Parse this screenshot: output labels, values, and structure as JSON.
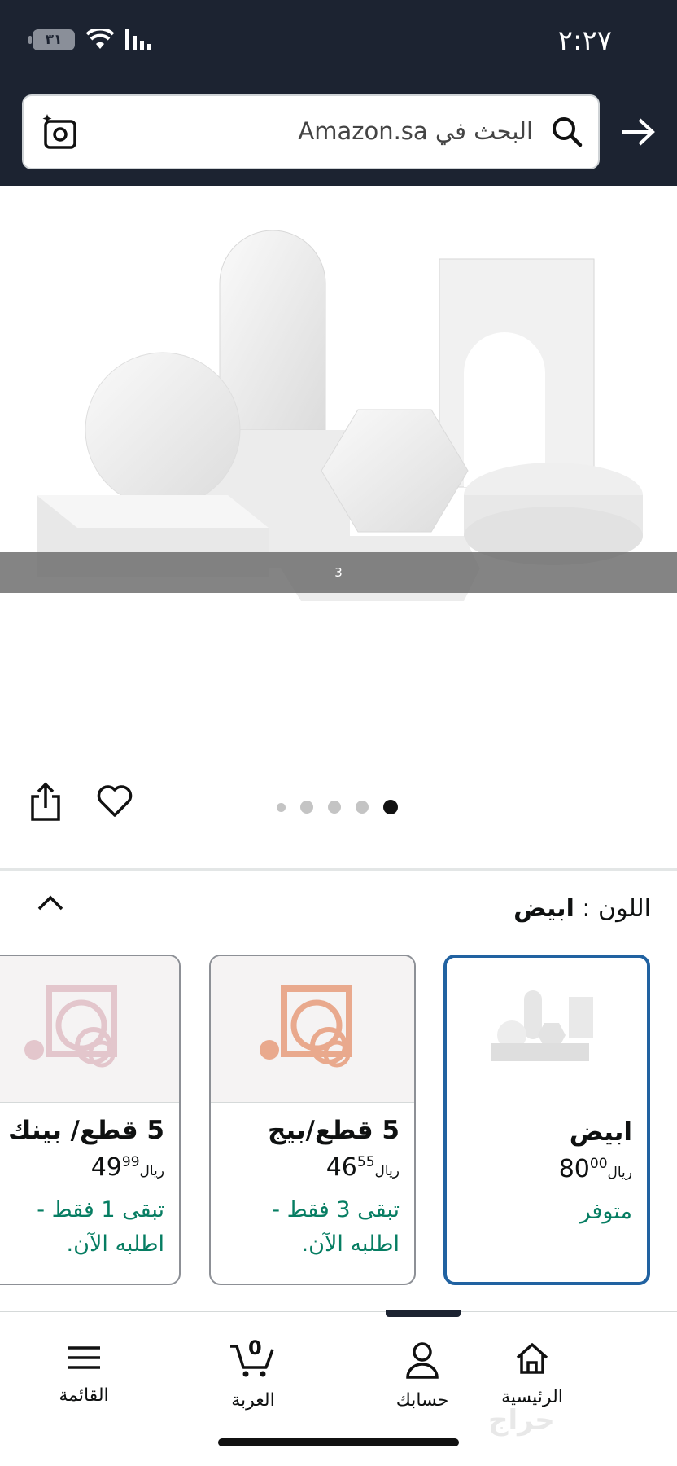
{
  "status_bar": {
    "time": "٢:٢٧",
    "battery": "٣١"
  },
  "search": {
    "placeholder": "البحث في Amazon.sa"
  },
  "gallery": {
    "overlay_text": "3",
    "total_images": 5,
    "active_index": 5
  },
  "variation": {
    "label": "اللون :",
    "selected": "ابيض"
  },
  "swatches": [
    {
      "name": "ابيض",
      "price_whole": "80",
      "price_fraction": "00",
      "currency": "ريال",
      "stock": "متوفر",
      "selected": true
    },
    {
      "name": "5 قطع/بيج",
      "price_whole": "46",
      "price_fraction": "55",
      "currency": "ريال",
      "stock": "تبقى 3 فقط - اطلبه الآن.",
      "selected": false
    },
    {
      "name": "5 قطع/ بينك",
      "price_whole": "49",
      "price_fraction": "99",
      "currency": "ريال",
      "stock": "تبقى 1 فقط - اطلبه الآن.",
      "selected": false
    }
  ],
  "nav": {
    "home": "الرئيسية",
    "account": "حسابك",
    "cart": "العربة",
    "cart_count": "0",
    "menu": "القائمة"
  },
  "watermark": "حراج",
  "colors": {
    "header": "#1c2331",
    "selected_border": "#2162a1",
    "in_stock": "#067d62"
  }
}
